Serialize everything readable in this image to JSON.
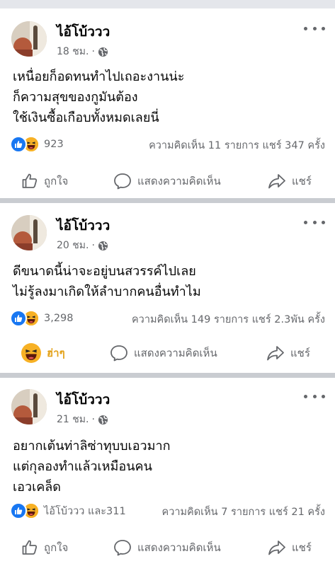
{
  "posts": [
    {
      "author": "ไอ้โบ้ววว",
      "time": "18 ชม.",
      "lines": [
        "เหนื่อยก็อดทนทำไปเถอะงานน่ะ",
        "ก็ความสุขของกูมันต้อง",
        "ใช้เงินซื้อเกือบทั้งหมดเลยนี่"
      ],
      "reaction_count": "923",
      "stats": "ความคิดเห็น 11 รายการ  แชร์ 347 ครั้ง",
      "actions": {
        "react": "ถูกใจ",
        "comment": "แสดงความคิดเห็น",
        "share": "แชร์"
      }
    },
    {
      "author": "ไอ้โบ้ววว",
      "time": "20 ชม.",
      "lines": [
        "ดีขนาดนี้น่าจะอยู่บนสวรรค์ไปเลย",
        "ไม่รู้ลงมาเกิดให้ลำบากคนอื่นทำไม"
      ],
      "reaction_count": "3,298",
      "stats": "ความคิดเห็น 149 รายการ  แชร์ 2.3พัน ครั้ง",
      "actions": {
        "react": "ฮ่าๆ",
        "comment": "แสดงความคิดเห็น",
        "share": "แชร์"
      }
    },
    {
      "author": "ไอ้โบ้ววว",
      "time": "21 ชม.",
      "lines": [
        "อยากเต้นท่าลิซ่าทุบบเอวมาก",
        "แต่กุลองทำแล้วเหมือนคน",
        "เอวเคล็ด"
      ],
      "reaction_count": "ไอ้โบ้ววว และ311",
      "stats": "ความคิดเห็น 7 รายการ  แชร์ 21 ครั้ง",
      "actions": {
        "react": "ถูกใจ",
        "comment": "แสดงความคิดเห็น",
        "share": "แชร์"
      }
    }
  ],
  "colors": {
    "secondary_text": "#65676b",
    "like_blue": "#1877f2",
    "haha_yellow": "#f7b125",
    "divider": "#c9ccd1"
  }
}
